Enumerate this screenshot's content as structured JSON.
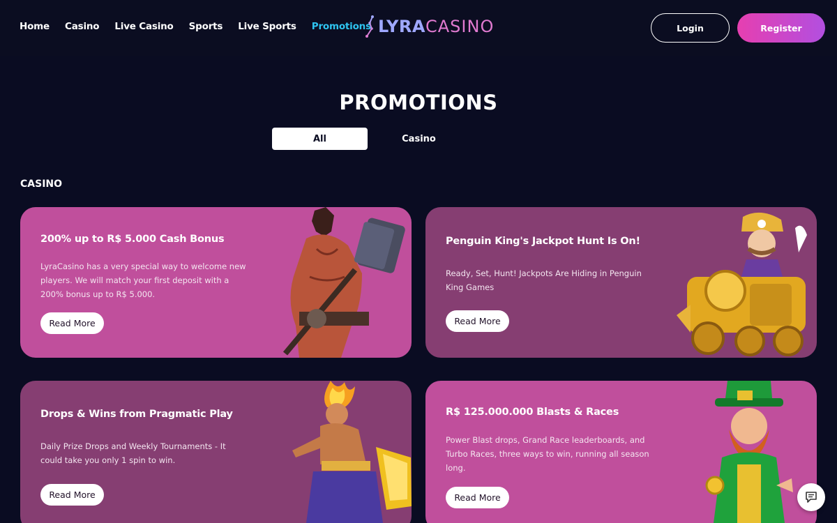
{
  "nav": {
    "items": [
      {
        "label": "Home",
        "active": false
      },
      {
        "label": "Casino",
        "active": false
      },
      {
        "label": "Live Casino",
        "active": false
      },
      {
        "label": "Sports",
        "active": false
      },
      {
        "label": "Live Sports",
        "active": false
      },
      {
        "label": "Promotions",
        "active": true
      }
    ],
    "active_color": "#2ec4f0"
  },
  "logo": {
    "part1": "LYRA",
    "part2": "CASINO"
  },
  "auth": {
    "login_label": "Login",
    "register_label": "Register"
  },
  "page": {
    "title": "PROMOTIONS"
  },
  "tabs": [
    {
      "label": "All",
      "selected": true
    },
    {
      "label": "Casino",
      "selected": false
    }
  ],
  "section": {
    "title": "CASINO"
  },
  "cards": [
    {
      "title": "200% up to R$ 5.000 Cash Bonus",
      "description": "LyraCasino has a very special way to welcome new players. We will match your first deposit with a 200% bonus up to R$ 5.000.",
      "button": "Read More",
      "art": "warrior-with-hammer"
    },
    {
      "title": "Penguin King's Jackpot Hunt Is On!",
      "description": "Ready, Set, Hunt! Jackpots Are Hiding in Penguin King Games",
      "button": "Read More",
      "art": "conductor-on-golden-train"
    },
    {
      "title": "Drops & Wins from Pragmatic Play",
      "description": "Daily Prize Drops and Weekly Tournaments - It could take you only 1 spin to win.",
      "button": "Read More",
      "art": "flame-haired-genie"
    },
    {
      "title": "R$ 125.000.000 Blasts & Races",
      "description": "Power Blast drops, Grand Race leaderboards, and Turbo Races, three ways to win, running all season long.",
      "button": "Read More",
      "art": "leprechaun-with-coin"
    }
  ],
  "colors": {
    "background": "#0a0c22",
    "card_pink": "#c04f9c",
    "card_purple": "#863e72",
    "register_gradient_start": "#e63fb0",
    "register_gradient_end": "#b24fe0"
  },
  "chat": {
    "icon": "chat-icon"
  }
}
